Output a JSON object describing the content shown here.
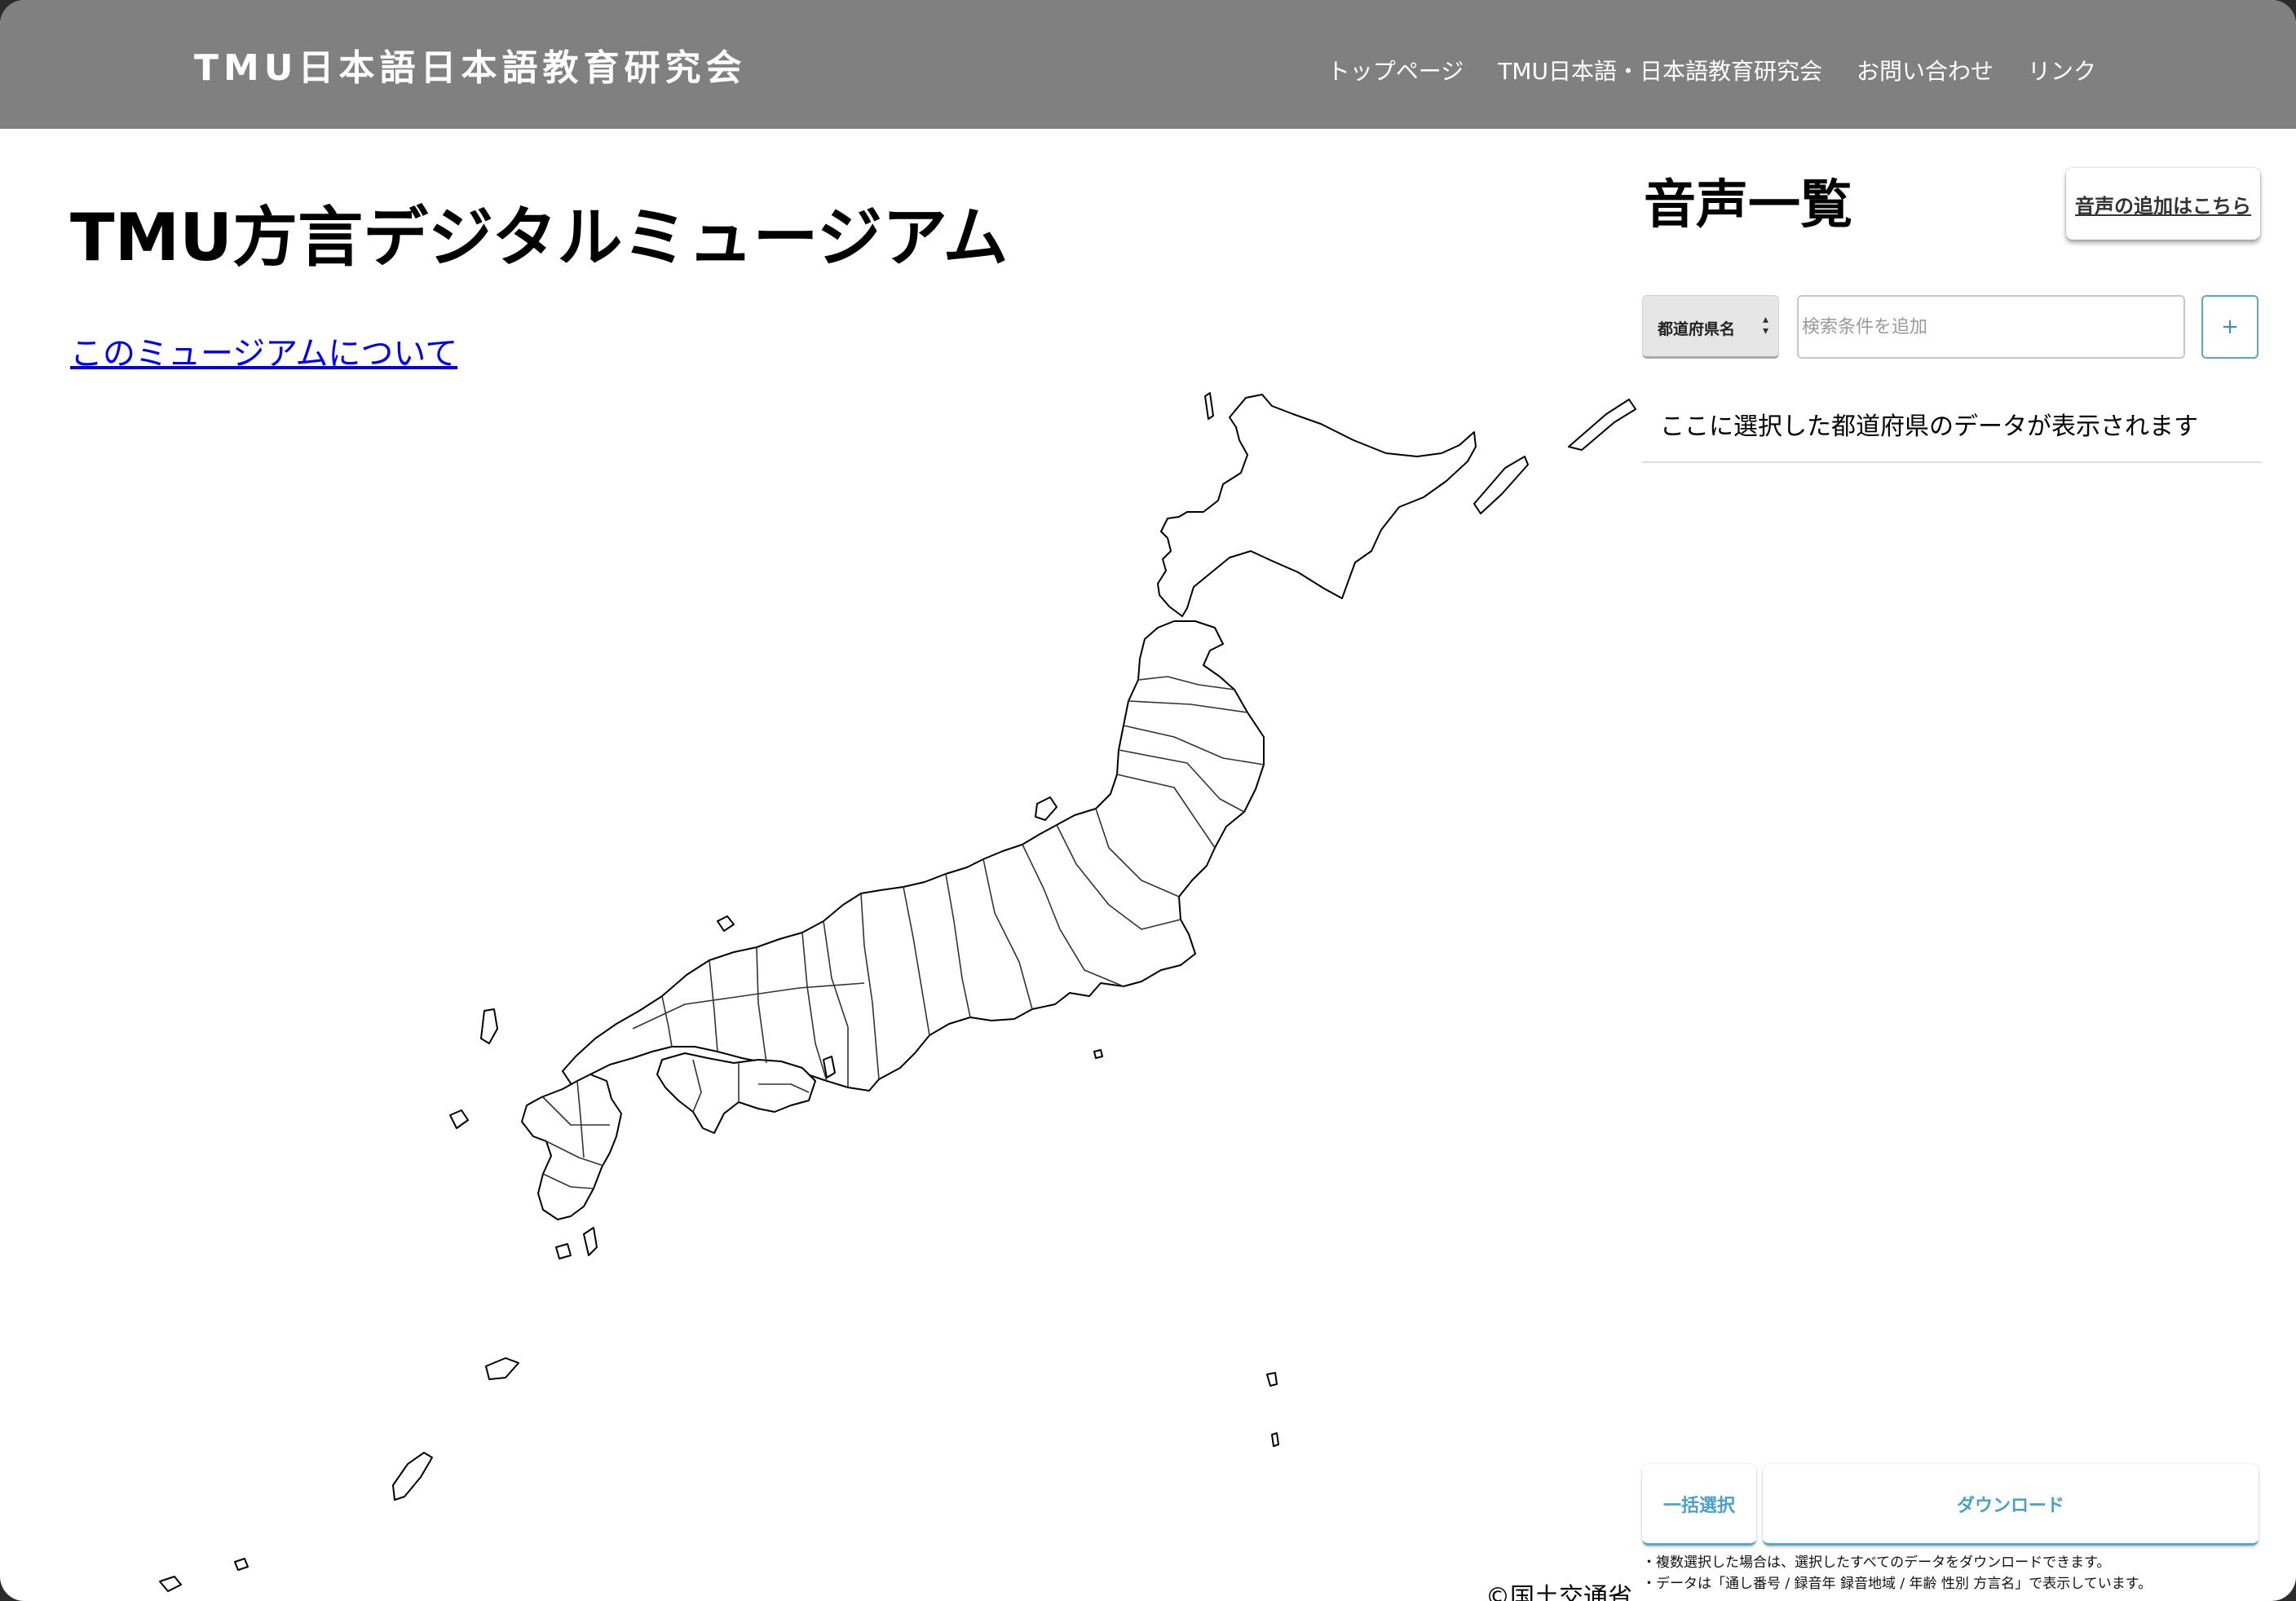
{
  "header": {
    "site_title": "TMU日本語日本語教育研究会",
    "nav": [
      {
        "label": "トップページ"
      },
      {
        "label": "TMU日本語・日本語教育研究会"
      },
      {
        "label": "お問い合わせ"
      },
      {
        "label": "リンク"
      }
    ]
  },
  "main": {
    "title": "TMU方言デジタルミュージアム",
    "about_link": "このミュージアムについて",
    "map_credit": "©国土交通省"
  },
  "panel": {
    "title": "音声一覧",
    "add_audio_button": "音声の追加はこちら",
    "filter_select": "都道府県名",
    "search_placeholder": "検索条件を追加",
    "add_condition_button": "+",
    "empty_message": "ここに選択した都道府県のデータが表示されます",
    "select_all_button": "一括選択",
    "download_button": "ダウンロード",
    "notes": [
      "・複数選択した場合は、選択したすべてのデータをダウンロードできます。",
      "・データは「通し番号 / 録音年 録音地域 / 年齢 性別 方言名」で表示しています。"
    ]
  },
  "colors": {
    "header_bg": "#808080",
    "accent": "#4aa0cc",
    "link": "#0000ee"
  }
}
